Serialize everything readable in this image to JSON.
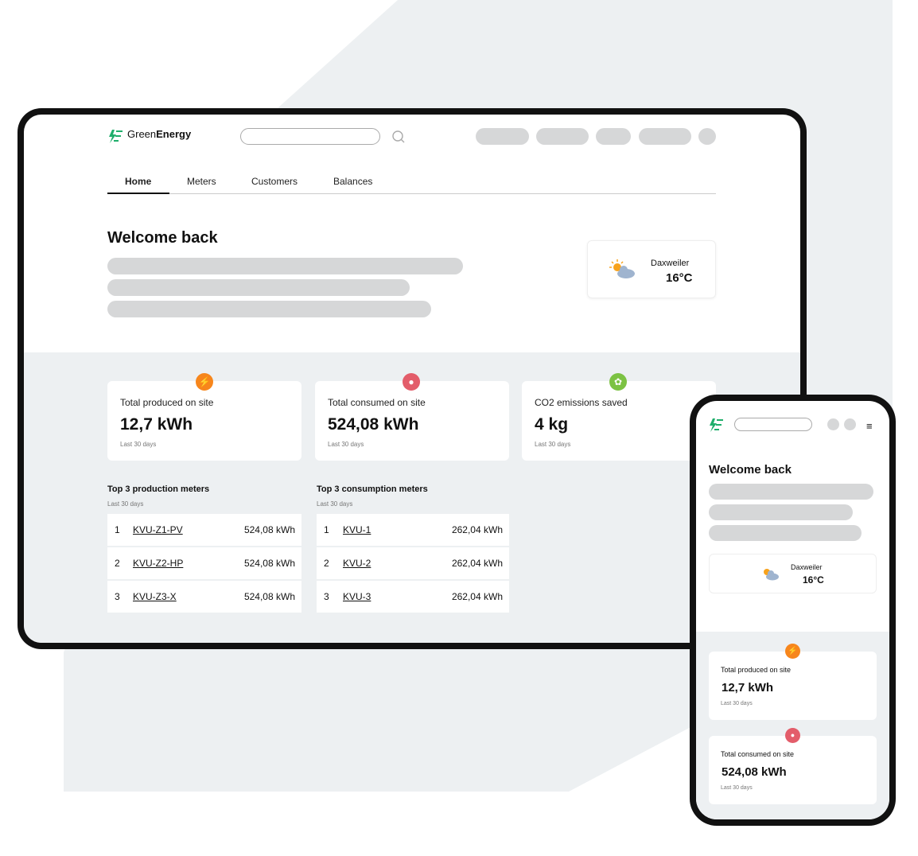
{
  "brand": {
    "name_light": "Green",
    "name_bold": "Energy",
    "color": "#1fae6b"
  },
  "nav": {
    "tabs": [
      "Home",
      "Meters",
      "Customers",
      "Balances"
    ],
    "active": "Home"
  },
  "welcome": {
    "title": "Welcome back"
  },
  "weather": {
    "location": "Daxweiler",
    "temperature": "16°C",
    "icon": "partly-sunny-icon"
  },
  "stats": [
    {
      "label": "Total produced on site",
      "value": "12,7 kWh",
      "period": "Last 30 days",
      "icon": "lightning-icon",
      "color": "#f7861c"
    },
    {
      "label": "Total consumed on site",
      "value": "524,08 kWh",
      "period": "Last 30 days",
      "icon": "lightbulb-icon",
      "color": "#e35d6a"
    },
    {
      "label": "CO2 emissions saved",
      "value": "4 kg",
      "period": "Last 30 days",
      "icon": "plant-icon",
      "color": "#7cc243"
    }
  ],
  "production": {
    "title": "Top 3 production meters",
    "period": "Last 30 days",
    "rows": [
      {
        "rank": "1",
        "meter": "KVU-Z1-PV",
        "value": "524,08 kWh"
      },
      {
        "rank": "2",
        "meter": "KVU-Z2-HP",
        "value": "524,08 kWh"
      },
      {
        "rank": "3",
        "meter": "KVU-Z3-X",
        "value": "524,08 kWh"
      }
    ]
  },
  "consumption": {
    "title": "Top 3 consumption meters",
    "period": "Last 30 days",
    "rows": [
      {
        "rank": "1",
        "meter": "KVU-1",
        "value": "262,04 kWh"
      },
      {
        "rank": "2",
        "meter": "KVU-2",
        "value": "262,04 kWh"
      },
      {
        "rank": "3",
        "meter": "KVU-3",
        "value": "262,04 kWh"
      }
    ]
  }
}
